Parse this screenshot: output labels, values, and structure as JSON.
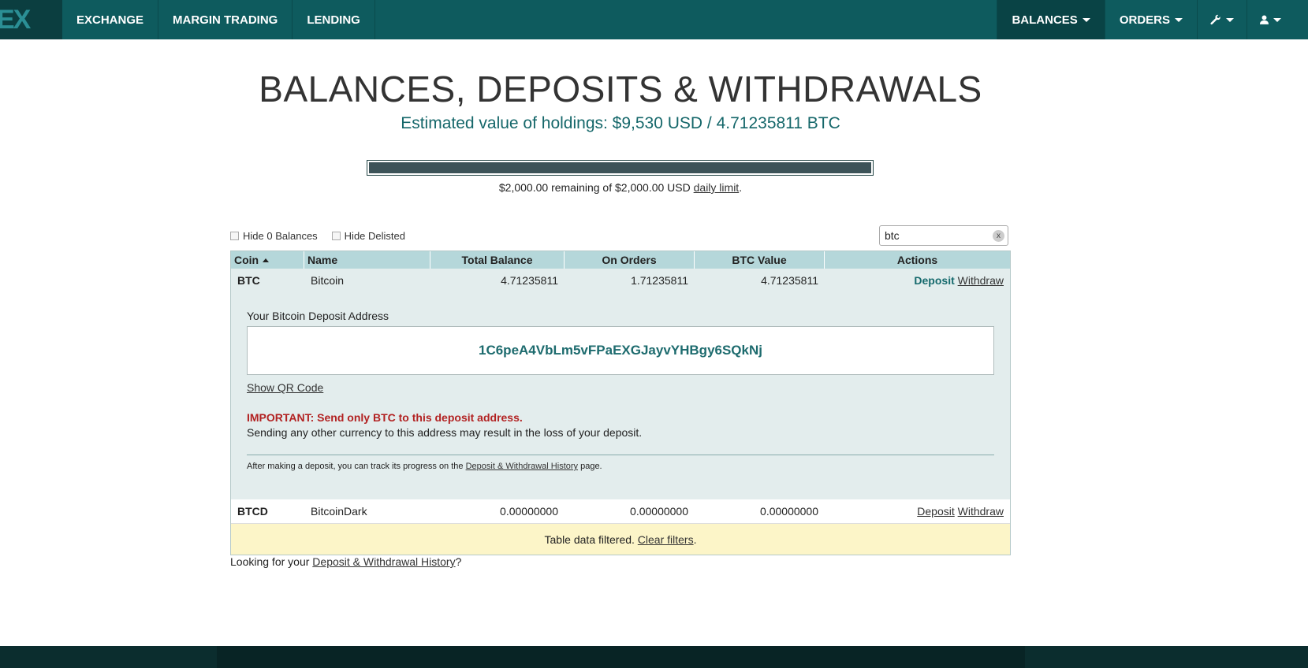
{
  "nav": {
    "logo": "EX",
    "left": [
      "EXCHANGE",
      "MARGIN TRADING",
      "LENDING"
    ],
    "balances": "BALANCES",
    "orders": "ORDERS"
  },
  "header": {
    "title": "BALANCES, DEPOSITS & WITHDRAWALS",
    "subtitle": "Estimated value of holdings: $9,530 USD / 4.71235811 BTC"
  },
  "limit": {
    "fraction": 1.0,
    "text_pre": "$2,000.00 remaining of $2,000.00 USD ",
    "link": "daily limit",
    "text_post": "."
  },
  "filters": {
    "hide_zero": "Hide 0 Balances",
    "hide_delisted": "Hide Delisted",
    "search_value": "btc",
    "search_clear": "x"
  },
  "table": {
    "headers": [
      "Coin",
      "Name",
      "Total Balance",
      "On Orders",
      "BTC Value",
      "Actions"
    ],
    "rows": [
      {
        "coin": "BTC",
        "name": "Bitcoin",
        "total": "4.71235811",
        "orders": "1.71235811",
        "btc_value": "4.71235811",
        "deposit": "Deposit",
        "withdraw": "Withdraw"
      },
      {
        "coin": "BTCD",
        "name": "BitcoinDark",
        "total": "0.00000000",
        "orders": "0.00000000",
        "btc_value": "0.00000000",
        "deposit": "Deposit",
        "withdraw": "Withdraw"
      }
    ],
    "deposit_panel": {
      "label": "Your Bitcoin Deposit Address",
      "address": "1C6peA4VbLm5vFPaEXGJayvYHBgy6SQkNj",
      "qr_link": "Show QR Code",
      "important": "IMPORTANT: Send only BTC to this deposit address.",
      "warning": "Sending any other currency to this address may result in the loss of your deposit.",
      "track_pre": "After making a deposit, you can track its progress on the ",
      "track_link": "Deposit & Withdrawal History",
      "track_post": " page."
    },
    "filtered": {
      "text": "Table data filtered. ",
      "link": "Clear filters",
      "post": "."
    }
  },
  "history": {
    "pre": "Looking for your ",
    "link": "Deposit & Withdrawal History",
    "post": "?"
  }
}
